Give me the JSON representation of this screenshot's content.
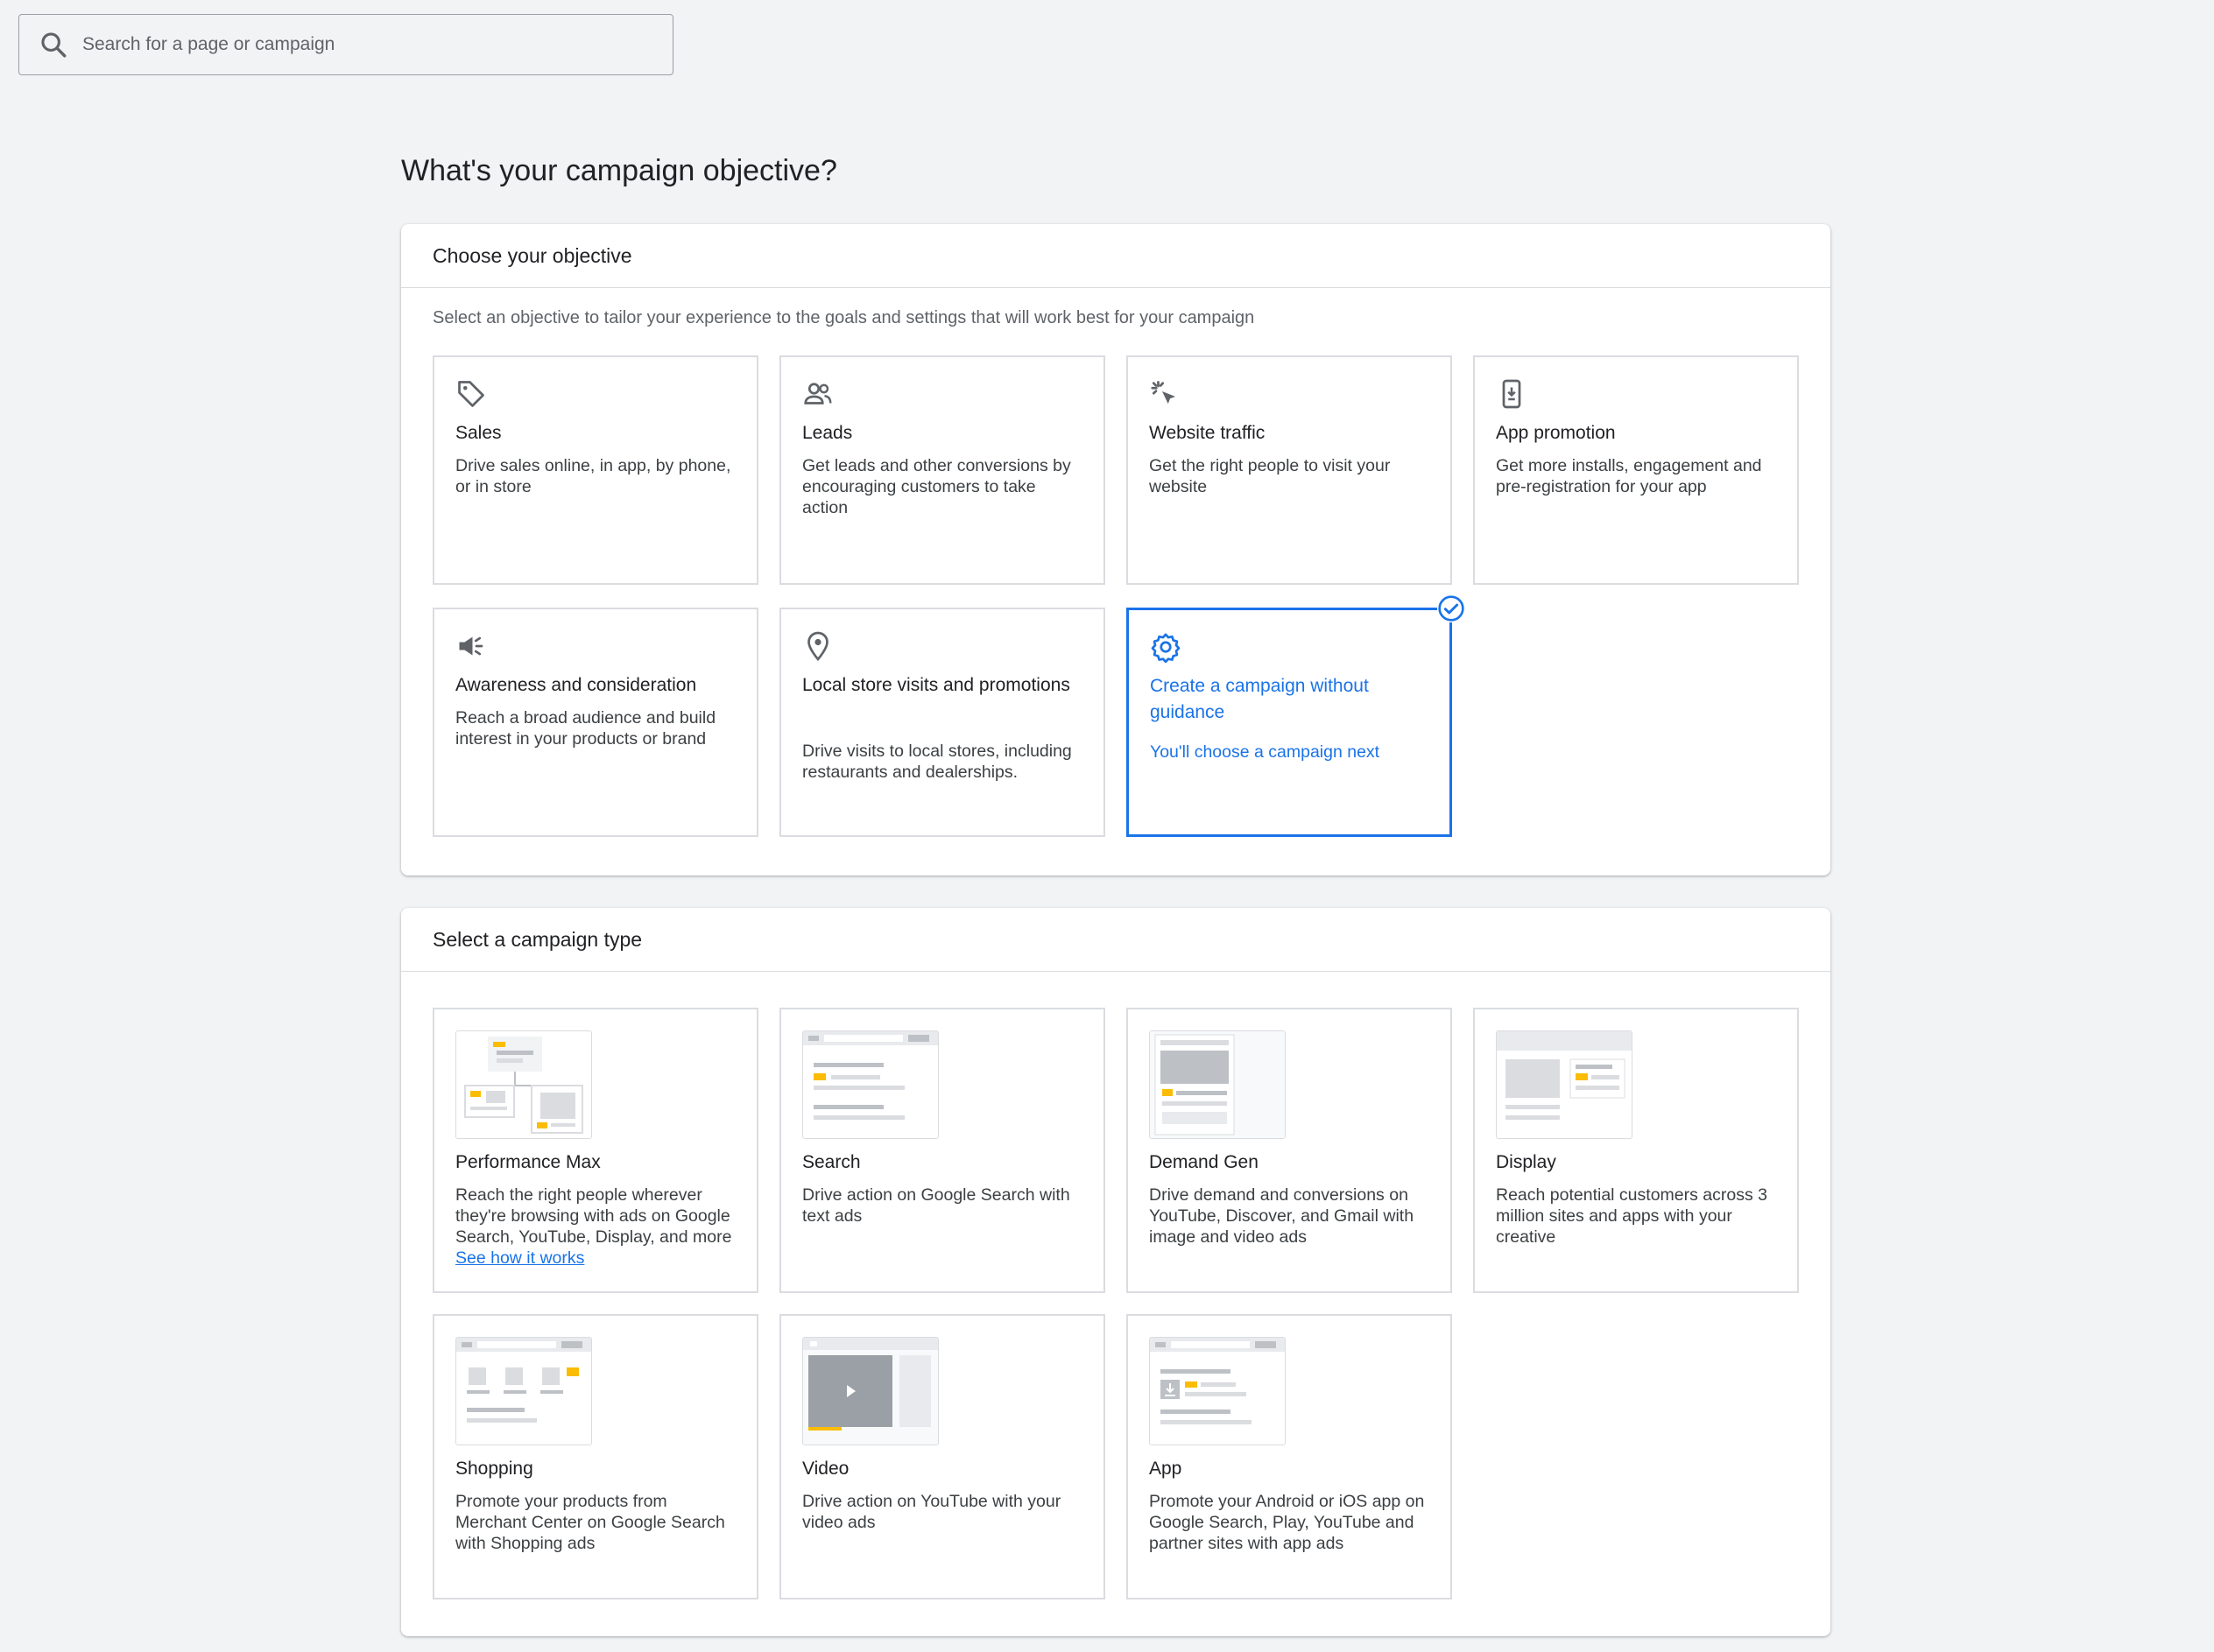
{
  "search": {
    "placeholder": "Search for a page or campaign"
  },
  "page_title": "What's your campaign objective?",
  "objective": {
    "header": "Choose your objective",
    "description": "Select an objective to tailor your experience to the goals and settings that will work best for your campaign",
    "tiles": [
      {
        "title": "Sales",
        "desc": "Drive sales online, in app, by phone, or in store",
        "icon": "tag-icon"
      },
      {
        "title": "Leads",
        "desc": "Get leads and other conversions by encouraging customers to take action",
        "icon": "people-icon"
      },
      {
        "title": "Website traffic",
        "desc": "Get the right people to visit your website",
        "icon": "cursor-click-icon"
      },
      {
        "title": "App promotion",
        "desc": "Get more installs, engagement and pre-registration for your app",
        "icon": "phone-download-icon"
      },
      {
        "title": "Awareness and consideration",
        "desc": "Reach a broad audience and build interest in your products or brand",
        "icon": "megaphone-icon"
      },
      {
        "title": "Local store visits and promotions",
        "desc": "Drive visits to local stores, including restaurants and dealerships.",
        "icon": "location-pin-icon"
      },
      {
        "title": "Create a campaign without guidance",
        "desc": "You'll choose a campaign next",
        "icon": "gear-icon",
        "selected": true
      }
    ]
  },
  "campaign_type": {
    "header": "Select a campaign type",
    "tiles": [
      {
        "title": "Performance Max",
        "desc": "Reach the right people wherever they're browsing with ads on Google Search, YouTube, Display, and more",
        "link": "See how it works"
      },
      {
        "title": "Search",
        "desc": "Drive action on Google Search with text ads"
      },
      {
        "title": "Demand Gen",
        "desc": "Drive demand and conversions on YouTube, Discover, and Gmail with image and video ads"
      },
      {
        "title": "Display",
        "desc": "Reach potential customers across 3 million sites and apps with your creative"
      },
      {
        "title": "Shopping",
        "desc": "Promote your products from Merchant Center on Google Search with Shopping ads"
      },
      {
        "title": "Video",
        "desc": "Drive action on YouTube with your video ads"
      },
      {
        "title": "App",
        "desc": "Promote your Android or iOS app on Google Search, Play, YouTube and partner sites with app ads"
      }
    ]
  },
  "colors": {
    "accent": "#1a73e8",
    "ad_yellow": "#fbbc04",
    "background": "#f1f3f4"
  }
}
